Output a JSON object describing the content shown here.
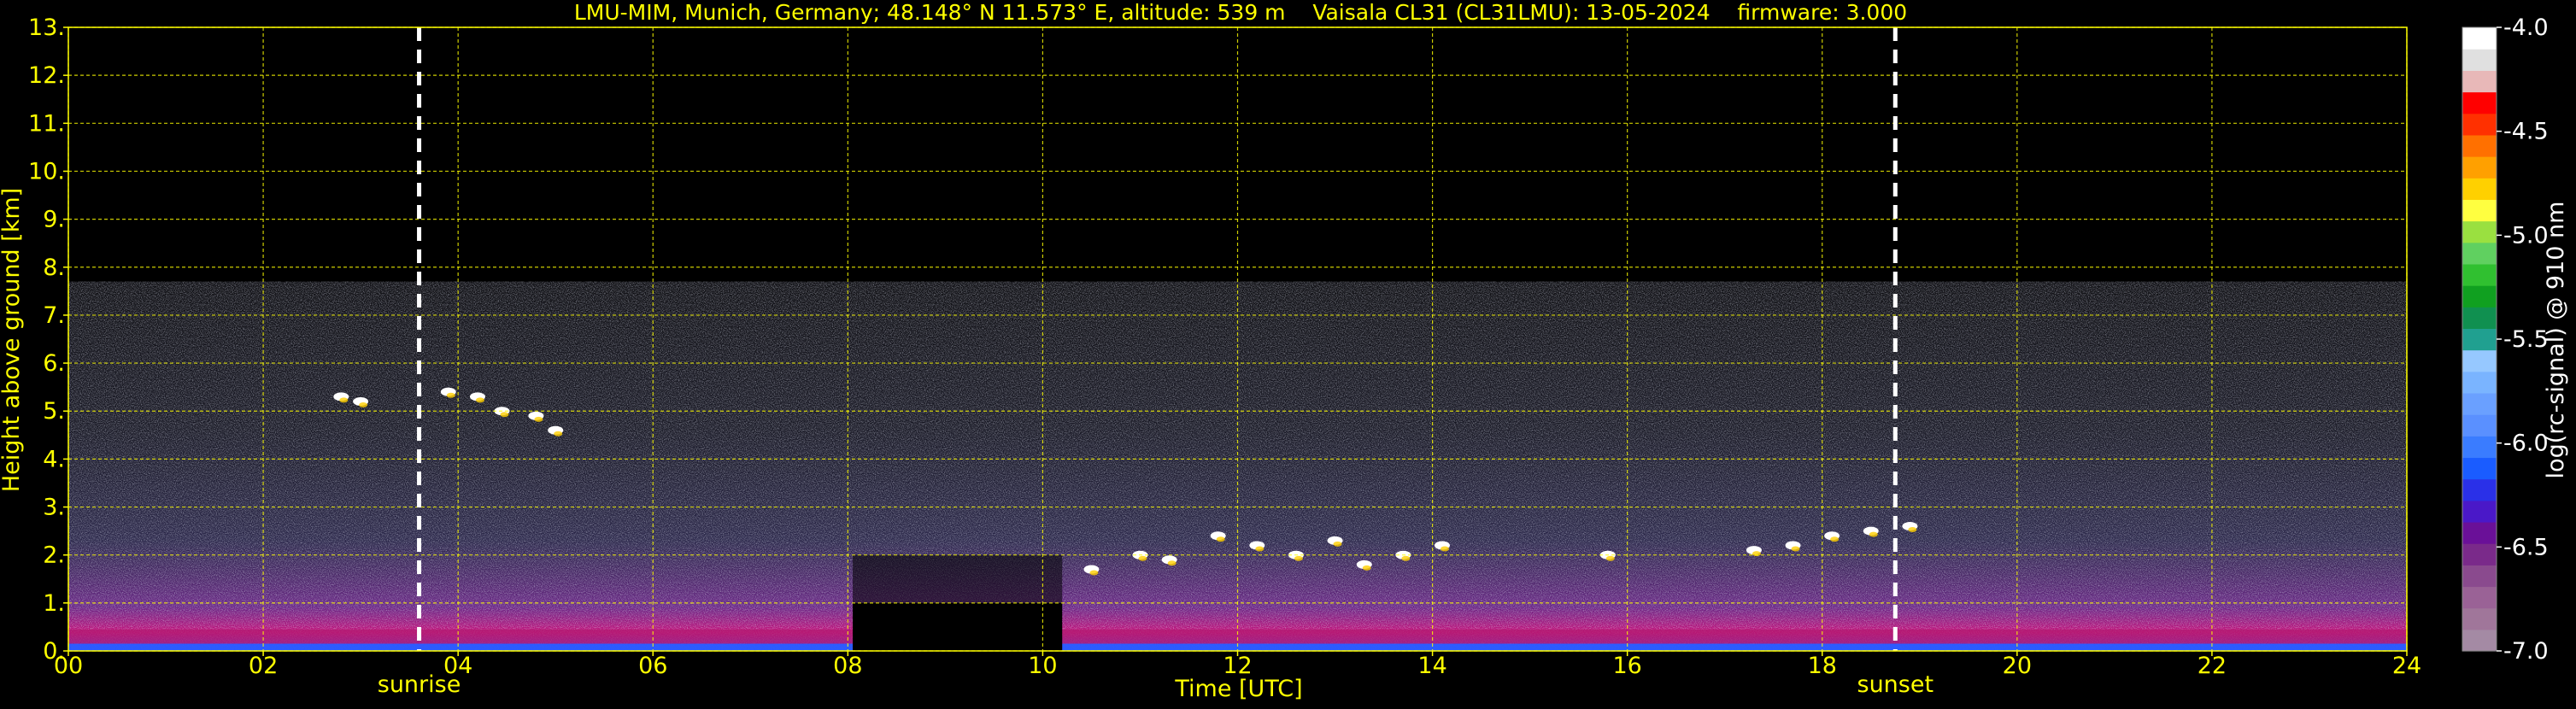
{
  "chart_data": {
    "type": "heatmap",
    "title": "LMU-MIM, Munich, Germany; 48.148° N 11.573° E, altitude: 539 m    Vaisala CL31 (CL31LMU): 13-05-2024    firmware: 3.000",
    "xlabel": "Time [UTC]",
    "ylabel": "Height above ground [km]",
    "xlim": [
      0,
      24
    ],
    "ylim": [
      0,
      13
    ],
    "x_ticks": [
      "00",
      "02",
      "04",
      "06",
      "08",
      "10",
      "12",
      "14",
      "16",
      "18",
      "20",
      "22",
      "24"
    ],
    "y_ticks": [
      "0.",
      "1.",
      "2.",
      "3.",
      "4.",
      "5.",
      "6.",
      "7.",
      "8.",
      "9.",
      "10.",
      "11.",
      "12.",
      "13."
    ],
    "grid": true,
    "data_top_km": 7.7,
    "events": [
      {
        "label": "sunrise",
        "time": 3.6
      },
      {
        "label": "sunset",
        "time": 18.75
      }
    ],
    "colorbar": {
      "label": "log(rc-signal) @ 910 nm",
      "range": [
        -7.0,
        -4.0
      ],
      "ticks": [
        "-4.0",
        "-4.5",
        "-5.0",
        "-5.5",
        "-6.0",
        "-6.5",
        "-7.0"
      ],
      "colors": [
        "#a48aa4",
        "#a0769a",
        "#9a6296",
        "#8a4a8e",
        "#7a2a8a",
        "#6a1098",
        "#4a18c8",
        "#2a30e8",
        "#1a5cff",
        "#3a7cff",
        "#5a90ff",
        "#6aa0ff",
        "#7ab4ff",
        "#96c8ff",
        "#20a090",
        "#109050",
        "#10a020",
        "#30c030",
        "#60d060",
        "#9ae040",
        "#ffff40",
        "#ffd000",
        "#ffa000",
        "#ff7000",
        "#ff3000",
        "#ff0000",
        "#e8b8b8",
        "#e0e0e0",
        "#ffffff"
      ]
    },
    "cloud_base_series": [
      {
        "time": 2.8,
        "height": 5.3
      },
      {
        "time": 3.0,
        "height": 5.2
      },
      {
        "time": 3.9,
        "height": 5.4
      },
      {
        "time": 4.2,
        "height": 5.3
      },
      {
        "time": 4.45,
        "height": 5.0
      },
      {
        "time": 4.8,
        "height": 4.9
      },
      {
        "time": 5.0,
        "height": 4.6
      },
      {
        "time": 10.5,
        "height": 1.7
      },
      {
        "time": 11.0,
        "height": 2.0
      },
      {
        "time": 11.3,
        "height": 1.9
      },
      {
        "time": 11.8,
        "height": 2.4
      },
      {
        "time": 12.2,
        "height": 2.2
      },
      {
        "time": 12.6,
        "height": 2.0
      },
      {
        "time": 13.0,
        "height": 2.3
      },
      {
        "time": 13.3,
        "height": 1.8
      },
      {
        "time": 13.7,
        "height": 2.0
      },
      {
        "time": 14.1,
        "height": 2.2
      },
      {
        "time": 15.8,
        "height": 2.0
      },
      {
        "time": 17.3,
        "height": 2.1
      },
      {
        "time": 17.7,
        "height": 2.2
      },
      {
        "time": 18.1,
        "height": 2.4
      },
      {
        "time": 18.5,
        "height": 2.5
      },
      {
        "time": 18.9,
        "height": 2.6
      }
    ],
    "data_gap": {
      "start": 8.05,
      "end": 10.2,
      "gap_top_km": 1.0
    }
  }
}
